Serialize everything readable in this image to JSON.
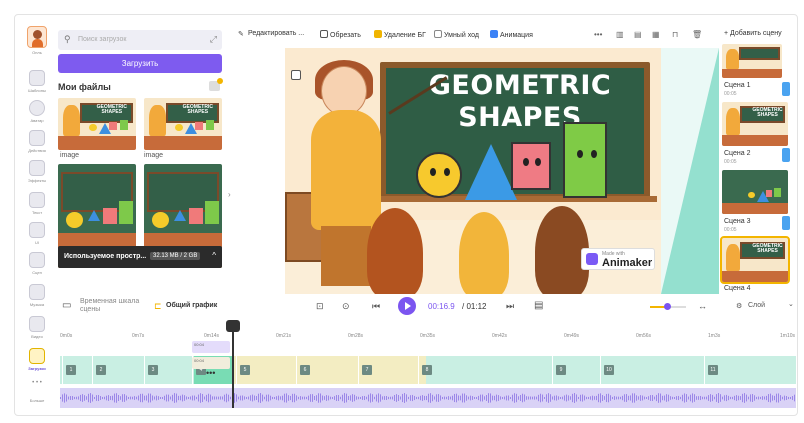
{
  "sidebar": {
    "items": [
      {
        "label": "Опль",
        "icon": "character-icon",
        "active": false
      },
      {
        "label": "Шаблоны",
        "icon": "templates-icon",
        "active": false
      },
      {
        "label": "Аватар",
        "icon": "avatar-icon",
        "active": false
      },
      {
        "label": "Действия",
        "icon": "actions-icon",
        "active": false
      },
      {
        "label": "Эффекты",
        "icon": "effects-icon",
        "active": false
      },
      {
        "label": "Текст",
        "icon": "text-icon",
        "active": false
      },
      {
        "label": "UI",
        "icon": "ui-icon",
        "active": false
      },
      {
        "label": "Сцен",
        "icon": "scene-icon",
        "active": false
      },
      {
        "label": "Музыка",
        "icon": "music-icon",
        "active": false
      },
      {
        "label": "Видео",
        "icon": "video-icon",
        "active": false
      },
      {
        "label": "Загрузки",
        "icon": "uploads-icon",
        "active": true
      },
      {
        "label": "Больше",
        "icon": "more-icon",
        "active": false
      }
    ]
  },
  "media_panel": {
    "search_placeholder": "Поиск загрузок",
    "upload_label": "Загрузить",
    "section_title": "Мои файлы",
    "files": [
      {
        "label": "image"
      },
      {
        "label": "image"
      }
    ],
    "thumb_title": "GEOMETRIC SHAPES",
    "storage_label": "Используемое простр...",
    "storage_value": "32.13 MB / 2 GB",
    "storage_toggle": "^"
  },
  "toolbar": {
    "edit_label": "Редактировать ...",
    "crop_label": "Обрезать",
    "remove_bg_label": "Удаление БГ",
    "smart_move_label": "Умный ход",
    "animation_label": "Анимация",
    "more_label": "•••"
  },
  "canvas": {
    "title_line1": "GEOMETRIC",
    "title_line2": "SHAPES",
    "watermark_small": "Made with",
    "watermark_brand": "Animaker"
  },
  "scenes": {
    "add_label": "+ Добавить сцену",
    "items": [
      {
        "name": "Сцена 1",
        "time": "00:05"
      },
      {
        "name": "Сцена 2",
        "time": "00:05"
      },
      {
        "name": "Сцена 3",
        "time": "00:05"
      },
      {
        "name": "Сцена 4",
        "time": "00:05"
      }
    ]
  },
  "playback": {
    "scene_timeline_label": "Временная шкала сцены",
    "overall_timeline_label": "Общий график",
    "current_time": "00:16.9",
    "total_time": "/ 01:12",
    "layer_label": "Слой"
  },
  "timeline": {
    "ticks": [
      "0m0s",
      "0m7s",
      "0m14s",
      "0m21s",
      "0m28s",
      "0m35s",
      "0m42s",
      "0m49s",
      "0m56s",
      "1m3s",
      "1m10s"
    ],
    "scene_numbers": [
      "1",
      "2",
      "3",
      "4",
      "5",
      "6",
      "7",
      "8",
      "9",
      "10",
      "11"
    ],
    "clip_top": "00:04",
    "clip_bottom": "00:04"
  },
  "colors": {
    "accent": "#7b55f0",
    "scene_track": "#c9efe3",
    "audio_track": "#d9d2f6",
    "highlight": "#f3b500"
  }
}
